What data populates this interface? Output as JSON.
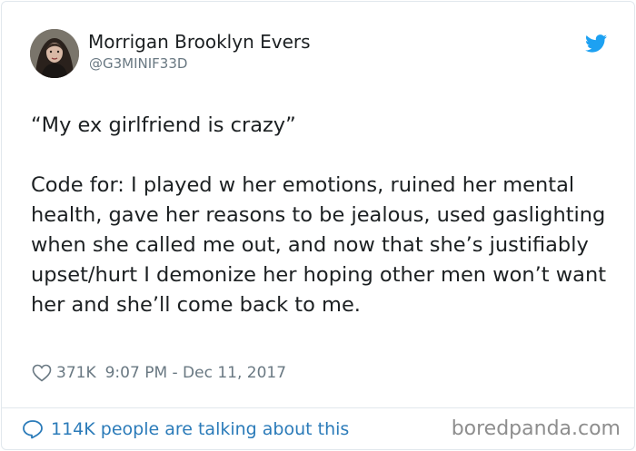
{
  "tweet": {
    "author": {
      "display_name": "Morrigan Brooklyn Evers",
      "handle": "@G3MINIF33D",
      "avatar_icon": "profile-photo"
    },
    "text": "“My ex girlfriend is crazy”\n\nCode for: I played w her emotions, ruined her mental health, gave her reasons to be jealous, used gaslighting when she called me out, and now that she’s justifiably upset/hurt I demonize her hoping other men won’t want her and she’ll come back to me.",
    "likes": "371K",
    "timestamp": "9:07 PM - Dec 11, 2017",
    "conversation_link": "114K people are talking about this"
  },
  "watermark": "boredpanda.com",
  "icons": {
    "brand": "twitter-bird-icon",
    "like": "heart-icon",
    "reply": "speech-bubble-icon"
  },
  "colors": {
    "text": "#1c2022",
    "muted": "#697882",
    "link": "#2b7bb9",
    "twitter_blue": "#1da1f2",
    "border": "#e1e8ed",
    "watermark": "#8e8e8e"
  }
}
